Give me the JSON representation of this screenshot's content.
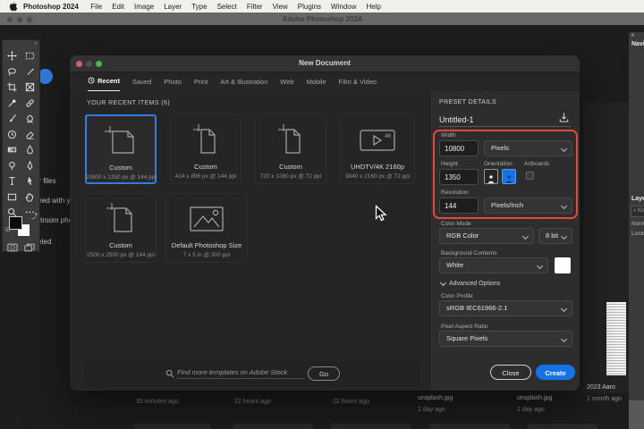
{
  "menubar": {
    "app_name": "Photoshop 2024",
    "menus": [
      "File",
      "Edit",
      "Image",
      "Layer",
      "Type",
      "Select",
      "Filter",
      "View",
      "Plugins",
      "Window",
      "Help"
    ]
  },
  "window": {
    "title": "Adobe Photoshop 2024"
  },
  "dialog": {
    "title": "New Document",
    "tabs": [
      "Recent",
      "Saved",
      "Photo",
      "Print",
      "Art & Illustration",
      "Web",
      "Mobile",
      "Film & Video"
    ],
    "active_tab": "Recent",
    "section_title": "YOUR RECENT ITEMS  (6)",
    "recent_items": [
      {
        "name": "Custom",
        "dims": "10800 x 1350 px @ 144 ppi",
        "selected": true
      },
      {
        "name": "Custom",
        "dims": "414 x 896 px @ 144 ppi",
        "selected": false
      },
      {
        "name": "Custom",
        "dims": "720 x 1280 px @ 72 ppi",
        "selected": false
      },
      {
        "name": "UHDTV/4K 2160p",
        "dims": "3840 x 2160 px @ 72 ppi",
        "selected": false
      },
      {
        "name": "Custom",
        "dims": "2500 x 2500 px @ 144 ppi",
        "selected": false
      },
      {
        "name": "Default Photoshop Size",
        "dims": "7 x 5 in @ 300 ppi",
        "selected": false
      }
    ],
    "search": {
      "placeholder": "Find more templates on Adobe Stock",
      "go_label": "Go"
    },
    "preset_details": {
      "title": "PRESET DETAILS",
      "doc_name": "Untitled-1",
      "width_label": "Width",
      "width_value": "10800",
      "width_unit": "Pixels",
      "height_label": "Height",
      "height_value": "1350",
      "orientation_label": "Orientation",
      "artboards_label": "Artboards",
      "resolution_label": "Resolution",
      "resolution_value": "144",
      "resolution_unit": "Pixels/Inch",
      "color_mode_label": "Color Mode",
      "color_mode": "RGB Color",
      "bit_depth": "8 bit",
      "background_label": "Background Contents",
      "background_value": "White",
      "advanced_label": "Advanced Options",
      "color_profile_label": "Color Profile",
      "color_profile": "sRGB IEC61966-2.1",
      "par_label": "Pixel Aspect Ratio",
      "par_value": "Square Pixels",
      "close_label": "Close",
      "create_label": "Create"
    }
  },
  "background": {
    "sidebar_items": [
      "Your files",
      "Shared with you",
      "Lightroom photos",
      "Deleted"
    ],
    "recent_files": [
      {
        "title": "",
        "time": "35 minutes ago"
      },
      {
        "title": "",
        "time": "22 hours ago"
      },
      {
        "title": "",
        "time": "22 hours ago"
      },
      {
        "title": "unsplash.jpg",
        "time": "1 day ago"
      },
      {
        "title": "unsplash.jpg",
        "time": "1 day ago"
      },
      {
        "title": "2023 Aaro",
        "time": "1 month ago"
      }
    ],
    "panels": {
      "navigator": "Navigator",
      "layers": "Layers",
      "kind_filter": "Kind",
      "blend_mode": "Normal",
      "lock_label": "Lock:"
    }
  },
  "toolbar_tools": [
    "move",
    "rectangular-marquee",
    "lasso",
    "object-selection",
    "crop",
    "frame",
    "eyedropper",
    "healing-brush",
    "brush",
    "clone-stamp",
    "history-brush",
    "eraser",
    "gradient",
    "blur",
    "dodge",
    "pen",
    "type",
    "path-selection",
    "rectangle",
    "hand",
    "zoom",
    "more-tools"
  ],
  "colors": {
    "accent_blue": "#1473e6",
    "selection_blue": "#2f7de1",
    "annotation_red": "#e8453c"
  }
}
